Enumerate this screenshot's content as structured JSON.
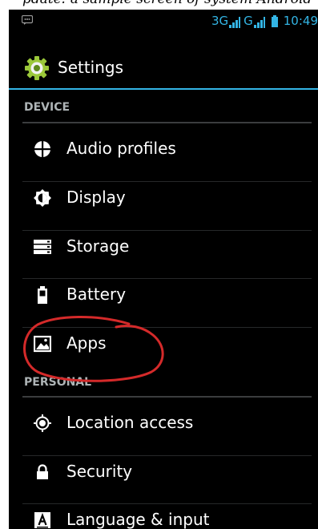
{
  "top_strip_text": "pdate: a sample screen of system Android",
  "status_bar": {
    "network_primary": "3G",
    "network_secondary": "G",
    "time": "10:49"
  },
  "action_bar": {
    "title": "Settings"
  },
  "sections": [
    {
      "header": "DEVICE",
      "items": [
        {
          "label": "Audio profiles",
          "icon": "audio-profiles-icon"
        },
        {
          "label": "Display",
          "icon": "display-icon"
        },
        {
          "label": "Storage",
          "icon": "storage-icon"
        },
        {
          "label": "Battery",
          "icon": "battery-icon"
        },
        {
          "label": "Apps",
          "icon": "apps-icon"
        }
      ]
    },
    {
      "header": "PERSONAL",
      "items": [
        {
          "label": "Location access",
          "icon": "location-icon"
        },
        {
          "label": "Security",
          "icon": "lock-icon"
        },
        {
          "label": "Language & input",
          "icon": "language-icon"
        }
      ]
    }
  ],
  "colors": {
    "accent": "#33b5e5",
    "background": "#000000",
    "header_text": "#aeb4b6",
    "annotation": "#d42a2a"
  }
}
